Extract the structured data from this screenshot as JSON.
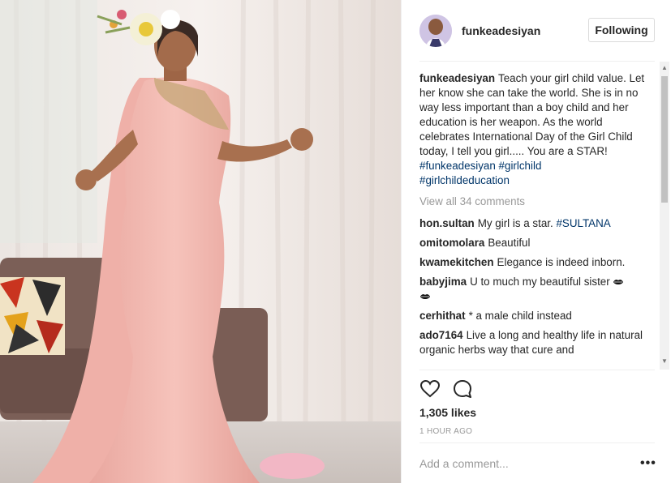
{
  "post": {
    "username": "funkeadesiyan",
    "follow_label": "Following",
    "caption": {
      "username": "funkeadesiyan",
      "text": "Teach your girl child value. Let her know she can take the world. She is in no way less important than a boy child and her education is her weapon. As the world celebrates International Day of the Girl Child today, I tell you girl..... You are a STAR!",
      "hashtags": [
        "#funkeadesiyan",
        "#girlchild",
        "#girlchildeducation"
      ]
    },
    "view_all_label": "View all 34 comments",
    "comments": [
      {
        "user": "hon.sultan",
        "text": "My girl is a star.",
        "tag": "#SULTANA"
      },
      {
        "user": "omitomolara",
        "text": "Beautiful"
      },
      {
        "user": "kwamekitchen",
        "text": "Elegance is indeed inborn."
      },
      {
        "user": "babyjima",
        "text": "U to much my beautiful sister"
      },
      {
        "user": "cerhithat",
        "text": "* a male child instead"
      },
      {
        "user": "ado7164",
        "text": "Live a long and healthy life in natural organic herbs way that cure and"
      }
    ],
    "likes": "1,305 likes",
    "time": "1 HOUR AGO",
    "add_comment_placeholder": "Add a comment...",
    "more_label": "•••"
  },
  "icons": {
    "like": "heart-icon",
    "comment": "comment-bubble-icon",
    "kiss": "kiss-lips-icon"
  },
  "colors": {
    "hashtag": "#003569",
    "muted": "#999999",
    "text": "#262626",
    "dress": "#f2b8b0"
  }
}
